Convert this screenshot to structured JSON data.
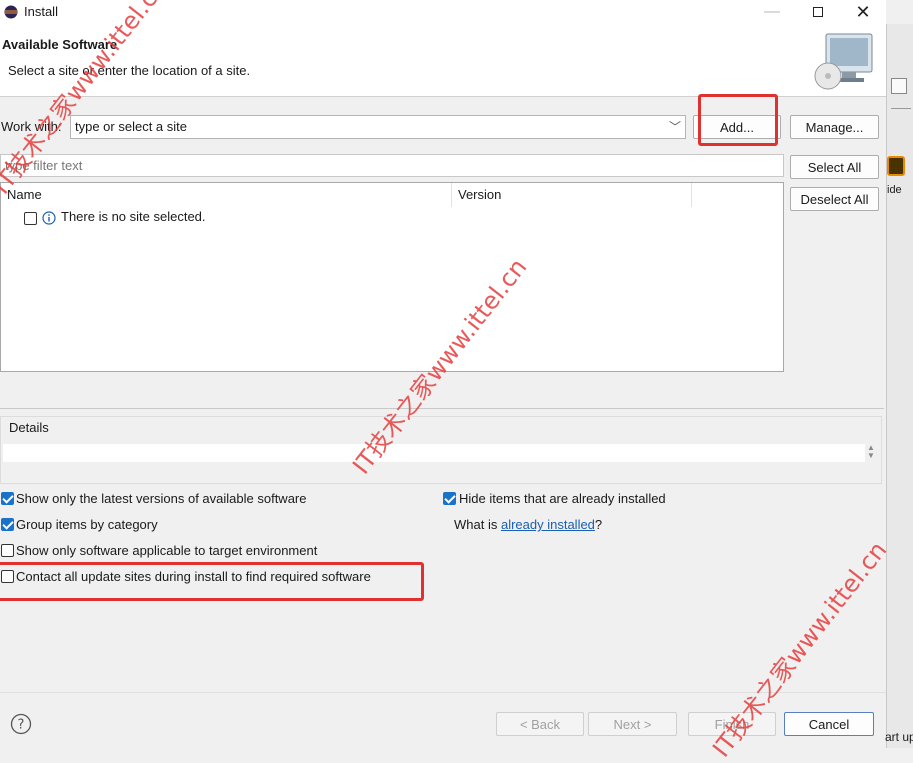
{
  "window": {
    "title": "Install"
  },
  "header": {
    "title": "Available Software",
    "description": "Select a site or enter the location of a site."
  },
  "work_with": {
    "label": "Work with:",
    "placeholder": "type or select a site",
    "add_label": "Add...",
    "manage_label": "Manage..."
  },
  "filter": {
    "placeholder": "type filter text"
  },
  "tree": {
    "columns": [
      "Name",
      "Version"
    ],
    "empty_message": "There is no site selected."
  },
  "side_buttons": {
    "select_all": "Select All",
    "deselect_all": "Deselect All"
  },
  "details": {
    "label": "Details"
  },
  "options": {
    "latest_only": {
      "label": "Show only the latest versions of available software",
      "checked": true
    },
    "group_by_category": {
      "label": "Group items by category",
      "checked": true
    },
    "target_env": {
      "label": "Show only software applicable to target environment",
      "checked": false
    },
    "contact_all": {
      "label": "Contact all update sites during install to find required software",
      "checked": false
    },
    "hide_installed": {
      "label": "Hide items that are already installed",
      "checked": true
    },
    "what_is_prefix": "What is ",
    "what_is_link": "already installed",
    "what_is_suffix": "?"
  },
  "footer": {
    "back_label": "< Back",
    "next_label": "Next >",
    "finish_label": "Finish",
    "cancel_label": "Cancel"
  },
  "background_partial": {
    "text1": "ide",
    "text2": "art up"
  },
  "watermarks": [
    "IT技术之家www.ittel.cn",
    "IT技术之家www.ittel.cn",
    "IT技术之家www.ittel.cn"
  ],
  "colors": {
    "highlight": "#e03030",
    "accent": "#1a73c8",
    "link": "#1a5fb4"
  }
}
